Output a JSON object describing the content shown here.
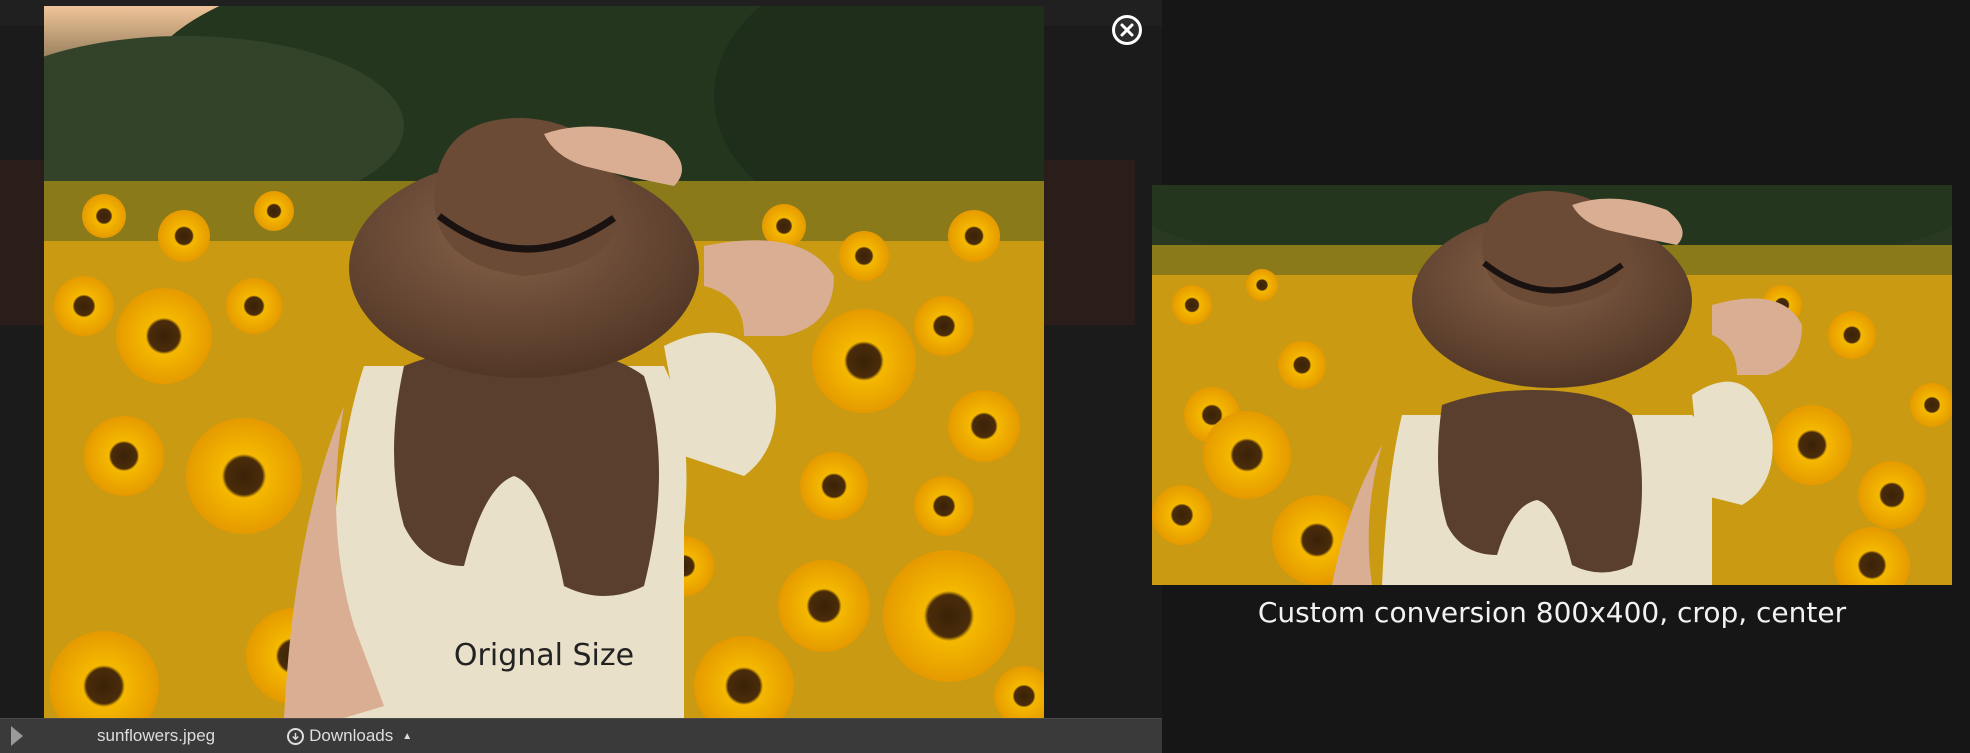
{
  "original": {
    "caption": "Orignal Size"
  },
  "cropped": {
    "caption": "Custom conversion 800x400, crop, center"
  },
  "lightbox": {
    "close_icon": "close-circle-icon"
  },
  "downloads_bar": {
    "file_name": "sunflowers.jpeg",
    "downloads_label": "Downloads",
    "icons": {
      "play": "play-icon",
      "downloads": "download-circle-icon",
      "caret": "caret-up-icon"
    }
  },
  "colors": {
    "background": "#161616",
    "sunflower_yellow": "#f2b705",
    "hat_brown": "#6b4a36",
    "dress_cream": "#e8e0c8"
  }
}
